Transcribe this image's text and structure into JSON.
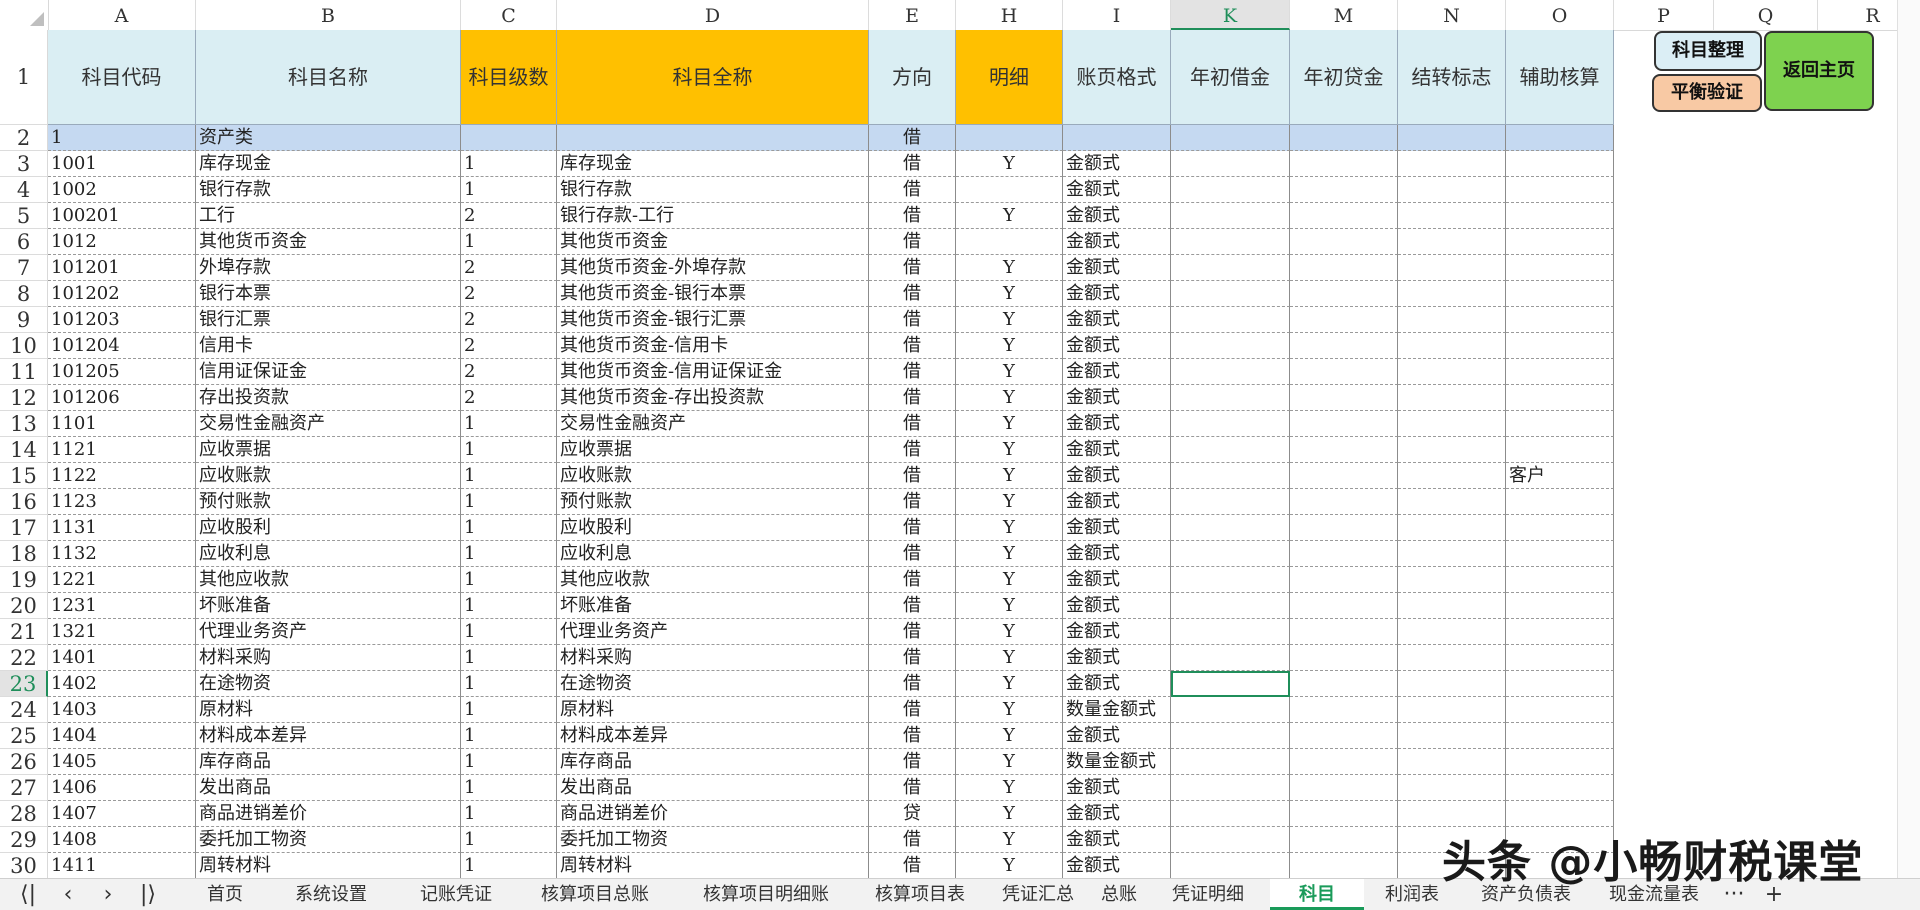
{
  "columns": [
    "A",
    "B",
    "C",
    "D",
    "E",
    "H",
    "I",
    "K",
    "M",
    "N",
    "O",
    "P",
    "Q",
    "R"
  ],
  "selected_column": "K",
  "selected_row": "23",
  "header_row": {
    "row_num": "1",
    "cells": [
      "科目代码",
      "科目名称",
      "科目级数",
      "科目全称",
      "方向",
      "明细",
      "账页格式",
      "年初借金",
      "年初贷金",
      "结转标志",
      "辅助核算"
    ]
  },
  "buttons": {
    "organize": "科目整理",
    "balance": "平衡验证",
    "home": "返回主页"
  },
  "rows": [
    {
      "n": "2",
      "a": "1",
      "b": "资产类",
      "c": "",
      "d": "",
      "e": "借",
      "h": "",
      "i": "",
      "o": ""
    },
    {
      "n": "3",
      "a": "1001",
      "b": "库存现金",
      "c": "1",
      "d": "库存现金",
      "e": "借",
      "h": "Y",
      "i": "金额式",
      "o": ""
    },
    {
      "n": "4",
      "a": "1002",
      "b": "银行存款",
      "c": "1",
      "d": "银行存款",
      "e": "借",
      "h": "",
      "i": "金额式",
      "o": ""
    },
    {
      "n": "5",
      "a": "100201",
      "b": "工行",
      "c": "2",
      "d": "银行存款-工行",
      "e": "借",
      "h": "Y",
      "i": "金额式",
      "o": ""
    },
    {
      "n": "6",
      "a": "1012",
      "b": "其他货币资金",
      "c": "1",
      "d": "其他货币资金",
      "e": "借",
      "h": "",
      "i": "金额式",
      "o": ""
    },
    {
      "n": "7",
      "a": "101201",
      "b": "外埠存款",
      "c": "2",
      "d": "其他货币资金-外埠存款",
      "e": "借",
      "h": "Y",
      "i": "金额式",
      "o": ""
    },
    {
      "n": "8",
      "a": "101202",
      "b": "银行本票",
      "c": "2",
      "d": "其他货币资金-银行本票",
      "e": "借",
      "h": "Y",
      "i": "金额式",
      "o": ""
    },
    {
      "n": "9",
      "a": "101203",
      "b": "银行汇票",
      "c": "2",
      "d": "其他货币资金-银行汇票",
      "e": "借",
      "h": "Y",
      "i": "金额式",
      "o": ""
    },
    {
      "n": "10",
      "a": "101204",
      "b": "信用卡",
      "c": "2",
      "d": "其他货币资金-信用卡",
      "e": "借",
      "h": "Y",
      "i": "金额式",
      "o": ""
    },
    {
      "n": "11",
      "a": "101205",
      "b": "信用证保证金",
      "c": "2",
      "d": "其他货币资金-信用证保证金",
      "e": "借",
      "h": "Y",
      "i": "金额式",
      "o": ""
    },
    {
      "n": "12",
      "a": "101206",
      "b": "存出投资款",
      "c": "2",
      "d": "其他货币资金-存出投资款",
      "e": "借",
      "h": "Y",
      "i": "金额式",
      "o": ""
    },
    {
      "n": "13",
      "a": "1101",
      "b": "交易性金融资产",
      "c": "1",
      "d": "交易性金融资产",
      "e": "借",
      "h": "Y",
      "i": "金额式",
      "o": ""
    },
    {
      "n": "14",
      "a": "1121",
      "b": "应收票据",
      "c": "1",
      "d": "应收票据",
      "e": "借",
      "h": "Y",
      "i": "金额式",
      "o": ""
    },
    {
      "n": "15",
      "a": "1122",
      "b": "应收账款",
      "c": "1",
      "d": "应收账款",
      "e": "借",
      "h": "Y",
      "i": "金额式",
      "o": "客户"
    },
    {
      "n": "16",
      "a": "1123",
      "b": "预付账款",
      "c": "1",
      "d": "预付账款",
      "e": "借",
      "h": "Y",
      "i": "金额式",
      "o": ""
    },
    {
      "n": "17",
      "a": "1131",
      "b": "应收股利",
      "c": "1",
      "d": "应收股利",
      "e": "借",
      "h": "Y",
      "i": "金额式",
      "o": ""
    },
    {
      "n": "18",
      "a": "1132",
      "b": "应收利息",
      "c": "1",
      "d": "应收利息",
      "e": "借",
      "h": "Y",
      "i": "金额式",
      "o": ""
    },
    {
      "n": "19",
      "a": "1221",
      "b": "其他应收款",
      "c": "1",
      "d": "其他应收款",
      "e": "借",
      "h": "Y",
      "i": "金额式",
      "o": ""
    },
    {
      "n": "20",
      "a": "1231",
      "b": "坏账准备",
      "c": "1",
      "d": "坏账准备",
      "e": "借",
      "h": "Y",
      "i": "金额式",
      "o": ""
    },
    {
      "n": "21",
      "a": "1321",
      "b": "代理业务资产",
      "c": "1",
      "d": "代理业务资产",
      "e": "借",
      "h": "Y",
      "i": "金额式",
      "o": ""
    },
    {
      "n": "22",
      "a": "1401",
      "b": "材料采购",
      "c": "1",
      "d": "材料采购",
      "e": "借",
      "h": "Y",
      "i": "金额式",
      "o": ""
    },
    {
      "n": "23",
      "a": "1402",
      "b": "在途物资",
      "c": "1",
      "d": "在途物资",
      "e": "借",
      "h": "Y",
      "i": "金额式",
      "o": ""
    },
    {
      "n": "24",
      "a": "1403",
      "b": "原材料",
      "c": "1",
      "d": "原材料",
      "e": "借",
      "h": "Y",
      "i": "数量金额式",
      "o": ""
    },
    {
      "n": "25",
      "a": "1404",
      "b": "材料成本差异",
      "c": "1",
      "d": "材料成本差异",
      "e": "借",
      "h": "Y",
      "i": "金额式",
      "o": ""
    },
    {
      "n": "26",
      "a": "1405",
      "b": "库存商品",
      "c": "1",
      "d": "库存商品",
      "e": "借",
      "h": "Y",
      "i": "数量金额式",
      "o": ""
    },
    {
      "n": "27",
      "a": "1406",
      "b": "发出商品",
      "c": "1",
      "d": "发出商品",
      "e": "借",
      "h": "Y",
      "i": "金额式",
      "o": ""
    },
    {
      "n": "28",
      "a": "1407",
      "b": "商品进销差价",
      "c": "1",
      "d": "商品进销差价",
      "e": "贷",
      "h": "Y",
      "i": "金额式",
      "o": ""
    },
    {
      "n": "29",
      "a": "1408",
      "b": "委托加工物资",
      "c": "1",
      "d": "委托加工物资",
      "e": "借",
      "h": "Y",
      "i": "金额式",
      "o": ""
    },
    {
      "n": "30",
      "a": "1411",
      "b": "周转材料",
      "c": "1",
      "d": "周转材料",
      "e": "借",
      "h": "Y",
      "i": "金额式",
      "o": ""
    }
  ],
  "tabs": [
    "首页",
    "系统设置",
    "记账凭证",
    "核算项目总账",
    "核算项目明细账",
    "核算项目表",
    "凭证汇总",
    "总账",
    "凭证明细",
    "科目",
    "利润表",
    "资产负债表",
    "现金流量表"
  ],
  "active_tab": "科目",
  "nav": {
    "first": "⟨|",
    "prev": "‹",
    "next": "›",
    "last": "|⟩",
    "more": "···",
    "add": "+"
  },
  "watermark": "头条 @小畅财税课堂"
}
